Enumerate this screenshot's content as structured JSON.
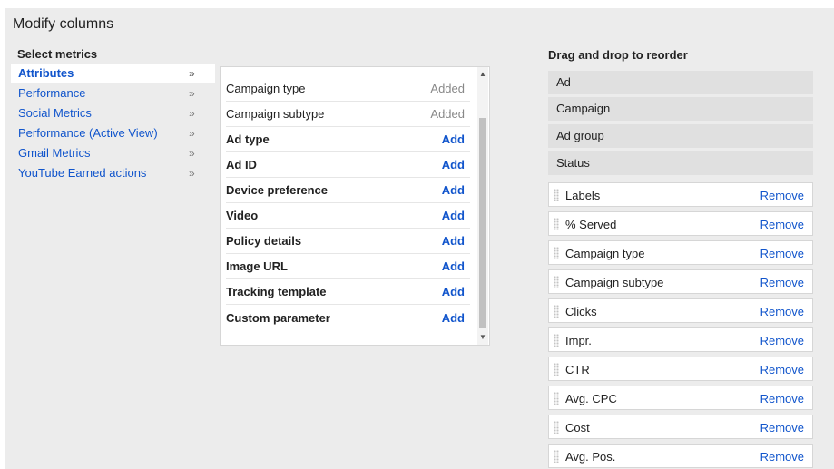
{
  "title": "Modify columns",
  "select_metrics_label": "Select metrics",
  "reorder_label": "Drag and drop to reorder",
  "categories": [
    {
      "label": "Attributes",
      "active": true
    },
    {
      "label": "Performance"
    },
    {
      "label": "Social Metrics"
    },
    {
      "label": "Performance (Active View)"
    },
    {
      "label": "Gmail Metrics"
    },
    {
      "label": "YouTube Earned actions"
    }
  ],
  "chevron": "»",
  "metrics": [
    {
      "name": "Campaign type",
      "action": "Added",
      "state": "added"
    },
    {
      "name": "Campaign subtype",
      "action": "Added",
      "state": "added"
    },
    {
      "name": "Ad type",
      "action": "Add",
      "state": "addable"
    },
    {
      "name": "Ad ID",
      "action": "Add",
      "state": "addable"
    },
    {
      "name": "Device preference",
      "action": "Add",
      "state": "addable"
    },
    {
      "name": "Video",
      "action": "Add",
      "state": "addable"
    },
    {
      "name": "Policy details",
      "action": "Add",
      "state": "addable"
    },
    {
      "name": "Image URL",
      "action": "Add",
      "state": "addable"
    },
    {
      "name": "Tracking template",
      "action": "Add",
      "state": "addable"
    },
    {
      "name": "Custom parameter",
      "action": "Add",
      "state": "addable"
    }
  ],
  "fixed_columns": [
    "Ad",
    "Campaign",
    "Ad group",
    "Status"
  ],
  "remove_label": "Remove",
  "movable_columns": [
    "Labels",
    "% Served",
    "Campaign type",
    "Campaign subtype",
    "Clicks",
    "Impr.",
    "CTR",
    "Avg. CPC",
    "Cost",
    "Avg. Pos."
  ],
  "colors": {
    "link": "#1155cc",
    "panel": "#ececec",
    "fixed_bg": "#e0e0e0"
  }
}
